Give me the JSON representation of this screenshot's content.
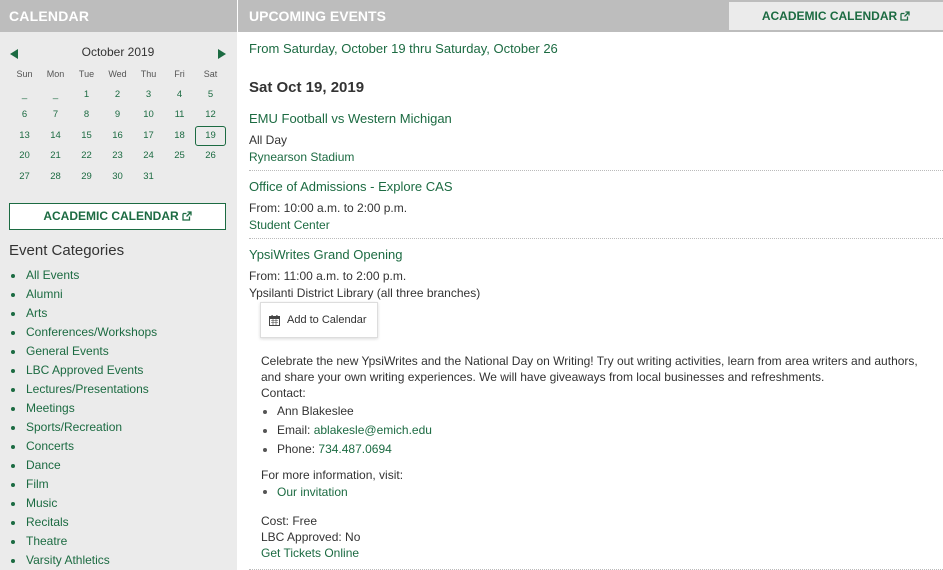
{
  "left": {
    "header": "CALENDAR",
    "calendar": {
      "month_label": "October 2019",
      "weekdays": [
        "Sun",
        "Mon",
        "Tue",
        "Wed",
        "Thu",
        "Fri",
        "Sat"
      ],
      "weeks": [
        [
          "_",
          "_",
          "1",
          "2",
          "3",
          "4",
          "5"
        ],
        [
          "6",
          "7",
          "8",
          "9",
          "10",
          "11",
          "12"
        ],
        [
          "13",
          "14",
          "15",
          "16",
          "17",
          "18",
          "19"
        ],
        [
          "20",
          "21",
          "22",
          "23",
          "24",
          "25",
          "26"
        ],
        [
          "27",
          "28",
          "29",
          "30",
          "31",
          "",
          ""
        ]
      ],
      "selected_day": "19"
    },
    "academic_calendar_label": "ACADEMIC CALENDAR",
    "categories_title": "Event Categories",
    "categories": [
      "All Events",
      "Alumni",
      "Arts",
      "Conferences/Workshops",
      "General Events",
      "LBC Approved Events",
      "Lectures/Presentations",
      "Meetings",
      "Sports/Recreation",
      "Concerts",
      "Dance",
      "Film",
      "Music",
      "Recitals",
      "Theatre",
      "Varsity Athletics"
    ]
  },
  "right": {
    "header": "UPCOMING EVENTS",
    "academic_calendar_label": "ACADEMIC CALENDAR",
    "range": "From Saturday, October 19 thru Saturday, October 26",
    "day_title": "Sat Oct 19, 2019",
    "events": [
      {
        "title": "EMU Football vs Western Michigan",
        "time": "All Day",
        "location": "Rynearson Stadium"
      },
      {
        "title": "Office of Admissions - Explore CAS",
        "time": "From: 10:00 a.m. to 2:00 p.m.",
        "location": "Student Center"
      },
      {
        "title": "YpsiWrites Grand Opening",
        "time": "From: 11:00 a.m. to 2:00 p.m.",
        "location": "Ypsilanti District Library (all three branches)"
      }
    ],
    "add_to_calendar": "Add to Calendar",
    "description": "Celebrate the new YpsiWrites and the National Day on Writing! Try out writing activities, learn from area writers and authors, and share your own writing experiences. We will have giveaways from local businesses and refreshments.",
    "contact_label": "Contact:",
    "contact_name": "Ann Blakeslee",
    "email_label": "Email:",
    "email": "ablakesle@emich.edu",
    "phone_label": "Phone:",
    "phone": "734.487.0694",
    "more_info": "For more information, visit:",
    "invitation_link": "Our invitation",
    "cost": "Cost: Free",
    "lbc": "LBC Approved: No",
    "tickets": "Get Tickets Online"
  },
  "colors": {
    "accent": "#1c6b42",
    "header_bg": "#bdbdbd",
    "sidebar_bg": "#ebebeb"
  },
  "icons": [
    "prev-arrow-icon",
    "next-arrow-icon",
    "external-link-icon",
    "calendar-icon"
  ]
}
